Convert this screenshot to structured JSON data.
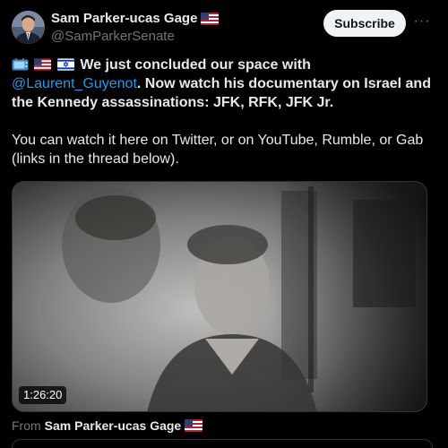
{
  "author": {
    "display_name": "Sam Parker-ucas Gage",
    "handle": "@SamParkerSenate"
  },
  "actions": {
    "subscribe_label": "Subscribe",
    "more_label": "···"
  },
  "tweet": {
    "line1_bold_start": "We just concluded our space with ",
    "mention": "@Laurent_Guyenot",
    "line1_bold_end": ". Now watch his documentary on Israel and the Kennedy assassinations: JFK, RFK, JFK Jr.",
    "paragraph2": "You can watch it here on Twitter, or on YouTube, Rumble, or Gab (links in the thread below)."
  },
  "media": {
    "duration": "1:26:20"
  },
  "source": {
    "prefix": "From ",
    "name": "Sam Parker-ucas Gage"
  },
  "icons": [
    "tv-icon",
    "us-flag-icon",
    "israel-flag-icon",
    "more-icon"
  ],
  "colors": {
    "background": "#000000",
    "text": "#e7e9ea",
    "secondary": "#71767b",
    "link": "#1d9bf0",
    "subscribe_bg": "#eff3f4"
  }
}
